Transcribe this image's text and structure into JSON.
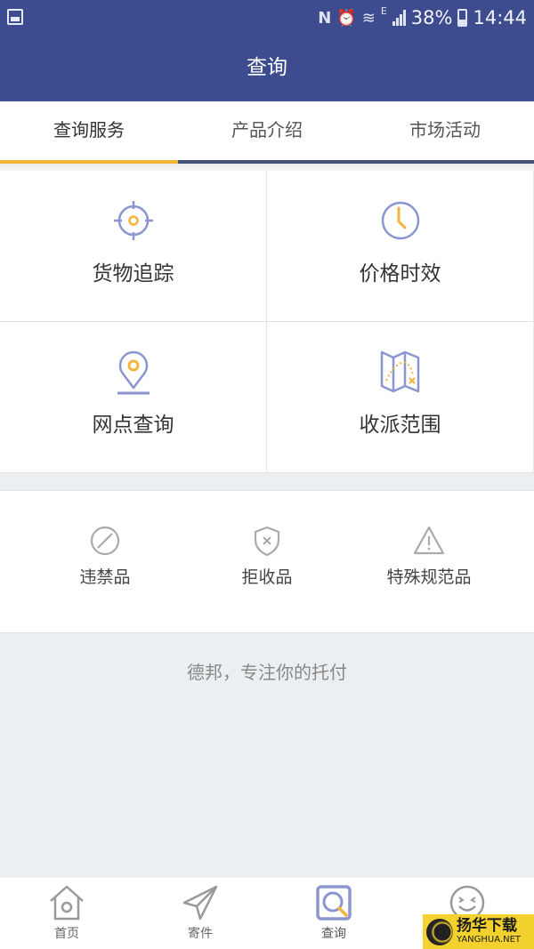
{
  "status_bar": {
    "battery": "38%",
    "time": "14:44",
    "network": "E",
    "icons": [
      "gallery-icon",
      "nfc-icon",
      "alarm-icon",
      "wifi-icon",
      "signal-icon",
      "battery-icon"
    ]
  },
  "app_bar": {
    "title": "查询"
  },
  "tabs": [
    {
      "label": "查询服务",
      "active": true
    },
    {
      "label": "产品介绍",
      "active": false
    },
    {
      "label": "市场活动",
      "active": false
    }
  ],
  "colors": {
    "primary": "#3d4b8f",
    "accent": "#f0b63a",
    "icon_blue": "#8b95cf",
    "icon_yellow": "#f0b63a"
  },
  "services": [
    {
      "label": "货物追踪",
      "icon": "crosshair-target-icon"
    },
    {
      "label": "价格时效",
      "icon": "clock-icon"
    },
    {
      "label": "网点查询",
      "icon": "map-pin-icon"
    },
    {
      "label": "收派范围",
      "icon": "folded-map-icon"
    }
  ],
  "rules": [
    {
      "label": "违禁品",
      "icon": "prohibited-icon"
    },
    {
      "label": "拒收品",
      "icon": "shield-x-icon"
    },
    {
      "label": "特殊规范品",
      "icon": "warning-triangle-icon"
    }
  ],
  "slogan": "德邦，专注你的托付",
  "bottom_nav": [
    {
      "label": "首页",
      "icon": "home-icon",
      "active": false
    },
    {
      "label": "寄件",
      "icon": "send-paper-plane-icon",
      "active": false
    },
    {
      "label": "查询",
      "icon": "search-icon",
      "active": true
    },
    {
      "label": "",
      "icon": "smiley-icon",
      "active": false
    }
  ],
  "watermark": {
    "cn": "扬华下载",
    "en": "YANGHUA.NET"
  }
}
